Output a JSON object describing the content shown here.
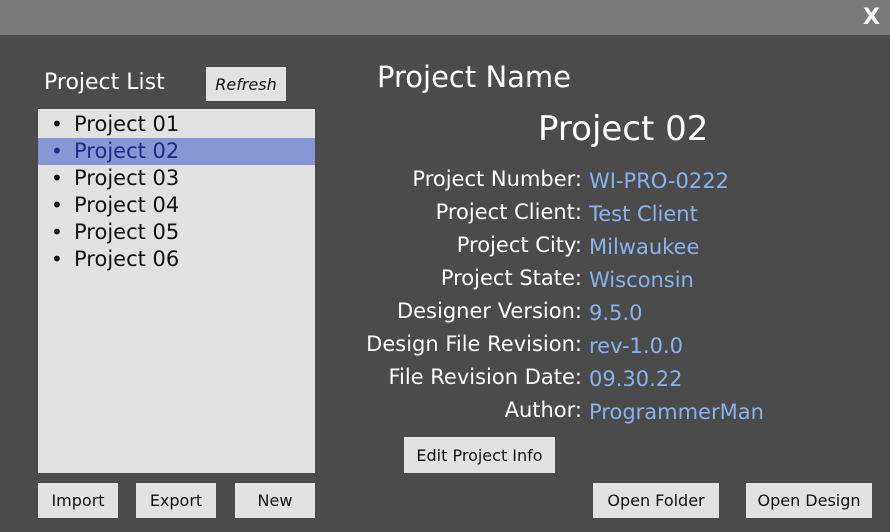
{
  "window": {
    "close_label": "X"
  },
  "project_list": {
    "title": "Project List",
    "refresh_label": "Refresh",
    "items": [
      {
        "label": "Project 01",
        "selected": false
      },
      {
        "label": "Project 02",
        "selected": true
      },
      {
        "label": "Project 03",
        "selected": false
      },
      {
        "label": "Project 04",
        "selected": false
      },
      {
        "label": "Project 05",
        "selected": false
      },
      {
        "label": "Project 06",
        "selected": false
      }
    ],
    "bullet": "•",
    "import_label": "Import",
    "export_label": "Export",
    "new_label": "New"
  },
  "details": {
    "heading": "Project Name",
    "project_name": "Project 02",
    "fields": [
      {
        "label": "Project Number:",
        "value": "WI-PRO-0222"
      },
      {
        "label": "Project Client:",
        "value": "Test Client"
      },
      {
        "label": "Project City:",
        "value": "Milwaukee"
      },
      {
        "label": "Project State:",
        "value": "Wisconsin"
      },
      {
        "label": "Designer Version:",
        "value": "9.5.0"
      },
      {
        "label": "Design File Revision:",
        "value": "rev-1.0.0"
      },
      {
        "label": "File Revision Date:",
        "value": "09.30.22"
      },
      {
        "label": "Author:",
        "value": "ProgrammerMan"
      }
    ],
    "edit_label": "Edit Project Info",
    "open_folder_label": "Open Folder",
    "open_design_label": "Open Design"
  },
  "colors": {
    "background": "#4b4b4b",
    "titlebar": "#7a7a7a",
    "selection": "#8797d4",
    "value_text": "#8ab2ec",
    "button": "#e2e2e2"
  }
}
